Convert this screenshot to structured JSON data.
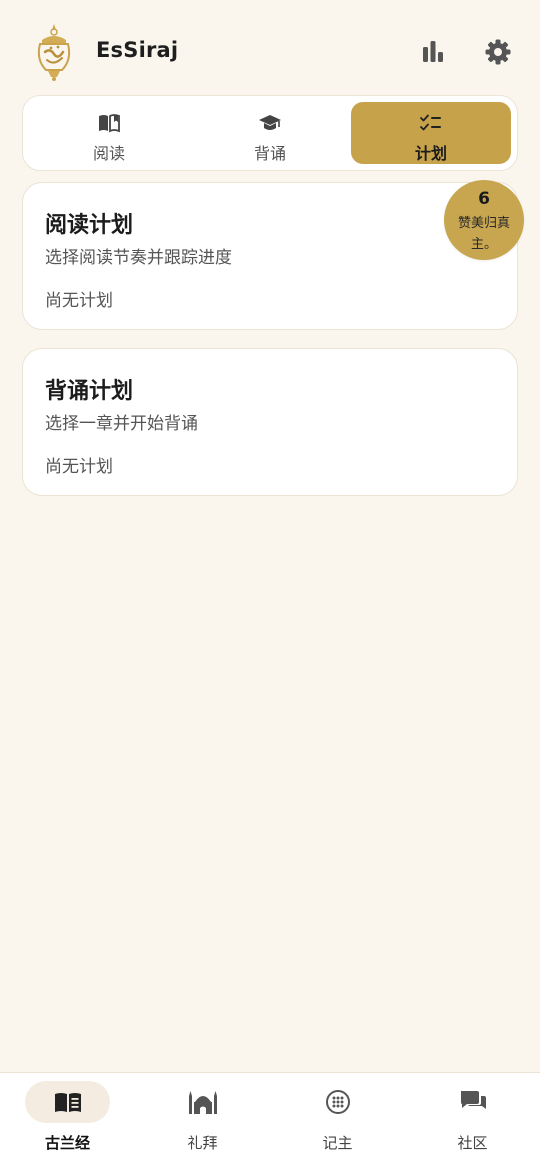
{
  "header": {
    "app_name": "EsSiraj",
    "logo_icon": "essiraj-lantern-logo",
    "actions": [
      {
        "icon": "bar-chart-icon"
      },
      {
        "icon": "gear-icon"
      }
    ]
  },
  "tabs": [
    {
      "label": "阅读",
      "icon": "book-icon",
      "active": false
    },
    {
      "label": "背诵",
      "icon": "graduation-cap-icon",
      "active": false
    },
    {
      "label": "计划",
      "icon": "checklist-icon",
      "active": true
    }
  ],
  "cards": [
    {
      "title": "阅读计划",
      "subtitle": "选择阅读节奏并跟踪进度",
      "status": "尚无计划"
    },
    {
      "title": "背诵计划",
      "subtitle": "选择一章并开始背诵",
      "status": "尚无计划"
    }
  ],
  "dhikr_badge": {
    "count": "6",
    "text": "赞美归真主。"
  },
  "bottom_nav": [
    {
      "label": "古兰经",
      "icon": "quran-book-icon",
      "active": true
    },
    {
      "label": "礼拜",
      "icon": "mosque-icon",
      "active": false
    },
    {
      "label": "记主",
      "icon": "tasbih-icon",
      "active": false
    },
    {
      "label": "社区",
      "icon": "chat-bubbles-icon",
      "active": false
    }
  ],
  "colors": {
    "background": "#faf6ee",
    "accent_gold": "#c6a24a",
    "card": "#ffffff",
    "text": "#1c1c1c"
  }
}
